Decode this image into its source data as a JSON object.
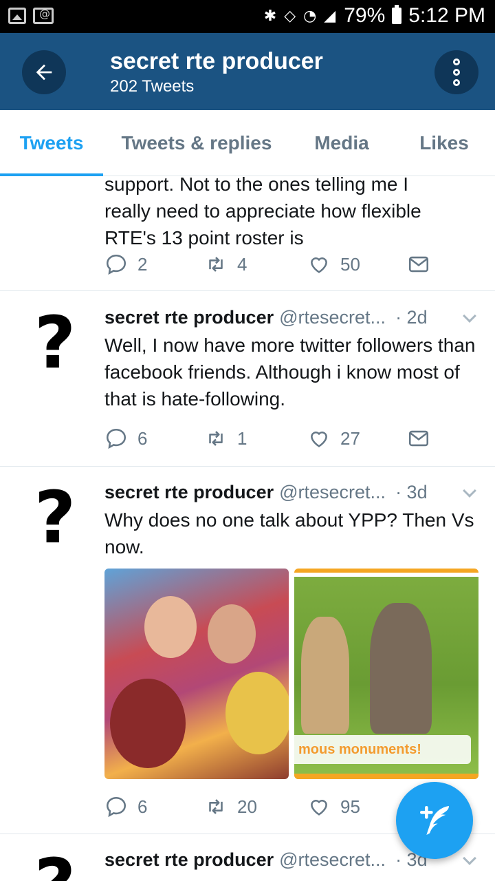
{
  "status_bar": {
    "battery": "79%",
    "time": "5:12 PM",
    "system_icons": "✱ ◇ ◔ ◢"
  },
  "header": {
    "title": "secret rte producer",
    "subtitle": "202 Tweets"
  },
  "tabs": [
    {
      "label": "Tweets",
      "active": true
    },
    {
      "label": "Tweets & replies",
      "active": false
    },
    {
      "label": "Media",
      "active": false
    },
    {
      "label": "Likes",
      "active": false
    }
  ],
  "tweets": [
    {
      "text_partial_top": "support. Not to the ones telling me I",
      "text": "really need to appreciate how flexible RTE's 13 point roster is",
      "replies": "2",
      "retweets": "4",
      "likes": "50"
    },
    {
      "name": "secret rte producer",
      "handle": "@rtesecret...",
      "time": "· 2d",
      "text": "Well, I now have more twitter followers than facebook friends. Although i know most of that is hate-following.",
      "replies": "6",
      "retweets": "1",
      "likes": "27"
    },
    {
      "name": "secret rte producer",
      "handle": "@rtesecret...",
      "time": "· 3d",
      "text": "Why does no one talk about YPP? Then Vs now.",
      "media_caption": "mous monuments!",
      "replies": "6",
      "retweets": "20",
      "likes": "95"
    },
    {
      "name": "secret rte producer",
      "handle": "@rtesecret...",
      "time": "· 3d"
    }
  ],
  "avatar_glyph": "?",
  "colors": {
    "header": "#1b5382",
    "accent": "#1da1f2",
    "muted": "#657786"
  }
}
